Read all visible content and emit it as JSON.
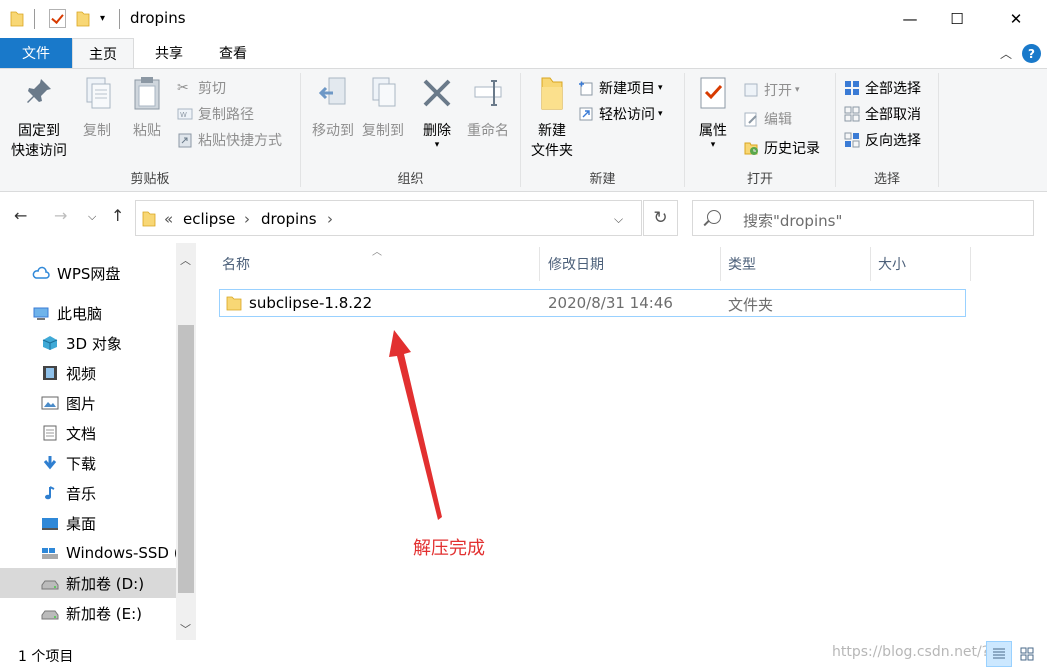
{
  "window": {
    "title": "dropins",
    "minimize": "—",
    "maximize": "☐",
    "close": "✕"
  },
  "ribbon_tabs": [
    {
      "label": "文件"
    },
    {
      "label": "主页"
    },
    {
      "label": "共享"
    },
    {
      "label": "查看"
    }
  ],
  "help": "?",
  "ribbon": {
    "clipboard": {
      "label": "剪贴板",
      "pin_line1": "固定到",
      "pin_line2": "快速访问",
      "copy": "复制",
      "paste": "粘贴",
      "cut": "剪切",
      "copy_path": "复制路径",
      "paste_shortcut": "粘贴快捷方式"
    },
    "organize": {
      "label": "组织",
      "move_to": "移动到",
      "copy_to": "复制到",
      "delete": "删除",
      "rename": "重命名"
    },
    "new": {
      "label": "新建",
      "new_folder_line1": "新建",
      "new_folder_line2": "文件夹",
      "new_item": "新建项目",
      "easy_access": "轻松访问"
    },
    "open": {
      "label": "打开",
      "properties": "属性",
      "open": "打开",
      "edit": "编辑",
      "history": "历史记录"
    },
    "select": {
      "label": "选择",
      "select_all": "全部选择",
      "select_none": "全部取消",
      "invert": "反向选择"
    }
  },
  "address": {
    "prefix": "«",
    "path": [
      "eclipse",
      "dropins"
    ],
    "separator": "›",
    "search_placeholder": "搜索\"dropins\""
  },
  "sidebar": {
    "items": [
      {
        "label": "WPS网盘",
        "icon": "cloud-icon"
      },
      {
        "label": "此电脑",
        "icon": "computer-icon"
      },
      {
        "label": "3D 对象",
        "icon": "cube-icon"
      },
      {
        "label": "视频",
        "icon": "film-icon"
      },
      {
        "label": "图片",
        "icon": "picture-icon"
      },
      {
        "label": "文档",
        "icon": "document-icon"
      },
      {
        "label": "下载",
        "icon": "download-icon"
      },
      {
        "label": "音乐",
        "icon": "music-icon"
      },
      {
        "label": "桌面",
        "icon": "desktop-icon"
      },
      {
        "label": "Windows-SSD (",
        "icon": "windows-drive-icon"
      },
      {
        "label": "新加卷 (D:)",
        "icon": "drive-icon"
      },
      {
        "label": "新加卷 (E:)",
        "icon": "drive-icon"
      }
    ]
  },
  "columns": {
    "name": "名称",
    "modified": "修改日期",
    "type": "类型",
    "size": "大小"
  },
  "files": [
    {
      "name": "subclipse-1.8.22",
      "modified": "2020/8/31 14:46",
      "type": "文件夹",
      "size": ""
    }
  ],
  "annotation": "解压完成",
  "status": {
    "count": "1 个项目",
    "watermark": "https://blog.csdn.net/???"
  },
  "colors": {
    "accent": "#1979ca",
    "annotation": "#e23030",
    "folder": "#f8d775"
  }
}
